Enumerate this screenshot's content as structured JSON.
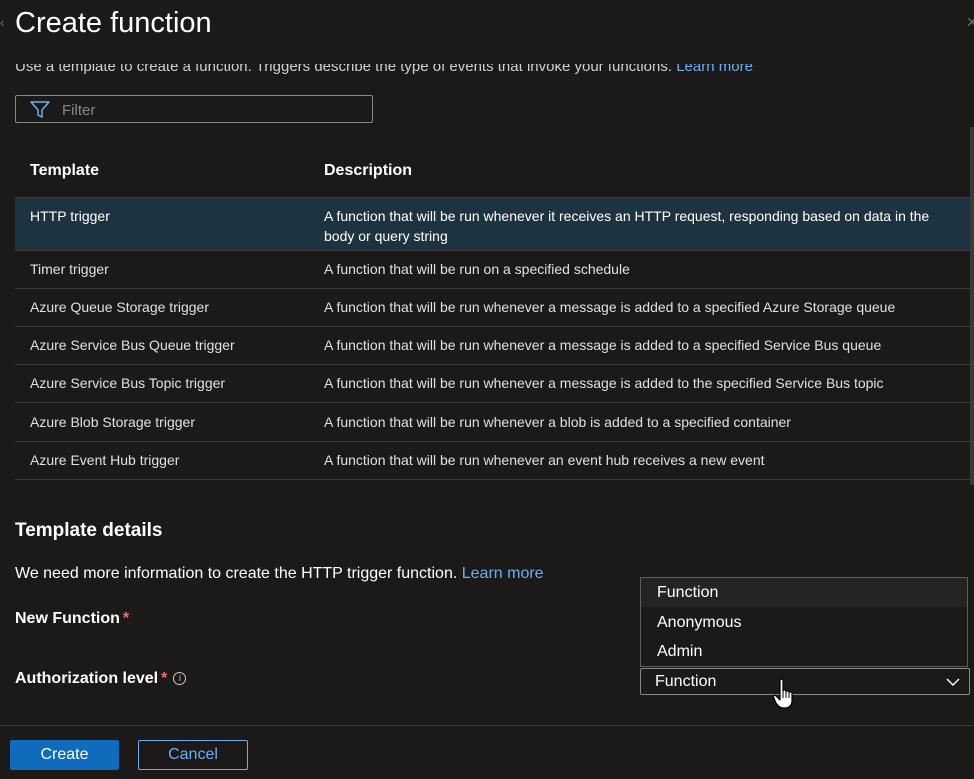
{
  "dialog": {
    "title": "Create function",
    "intro_text": "Use a template to create a function. Triggers describe the type of events that invoke your functions.",
    "intro_link": "Learn more"
  },
  "filter": {
    "placeholder": "Filter"
  },
  "table": {
    "headers": [
      "Template",
      "Description"
    ],
    "rows": [
      {
        "template": "HTTP trigger",
        "description": "A function that will be run whenever it receives an HTTP request, responding based on data in the body or query string",
        "selected": true
      },
      {
        "template": "Timer trigger",
        "description": "A function that will be run on a specified schedule"
      },
      {
        "template": "Azure Queue Storage trigger",
        "description": "A function that will be run whenever a message is added to a specified Azure Storage queue"
      },
      {
        "template": "Azure Service Bus Queue trigger",
        "description": "A function that will be run whenever a message is added to a specified Service Bus queue"
      },
      {
        "template": "Azure Service Bus Topic trigger",
        "description": "A function that will be run whenever a message is added to the specified Service Bus topic"
      },
      {
        "template": "Azure Blob Storage trigger",
        "description": "A function that will be run whenever a blob is added to a specified container"
      },
      {
        "template": "Azure Event Hub trigger",
        "description": "A function that will be run whenever an event hub receives a new event"
      }
    ]
  },
  "details": {
    "title": "Template details",
    "info_text": "We need more information to create the HTTP trigger function.",
    "info_link": "Learn more",
    "new_function_label": "New Function",
    "auth_label": "Authorization level",
    "required_mark": "*",
    "info_icon": "i",
    "auth_options": [
      "Function",
      "Anonymous",
      "Admin"
    ],
    "auth_selected": "Function"
  },
  "footer": {
    "create_label": "Create",
    "cancel_label": "Cancel"
  },
  "colors": {
    "accent": "#0f6cbd",
    "link": "#69aff6",
    "required": "#f1707b",
    "selected_row": "#1e3340"
  }
}
